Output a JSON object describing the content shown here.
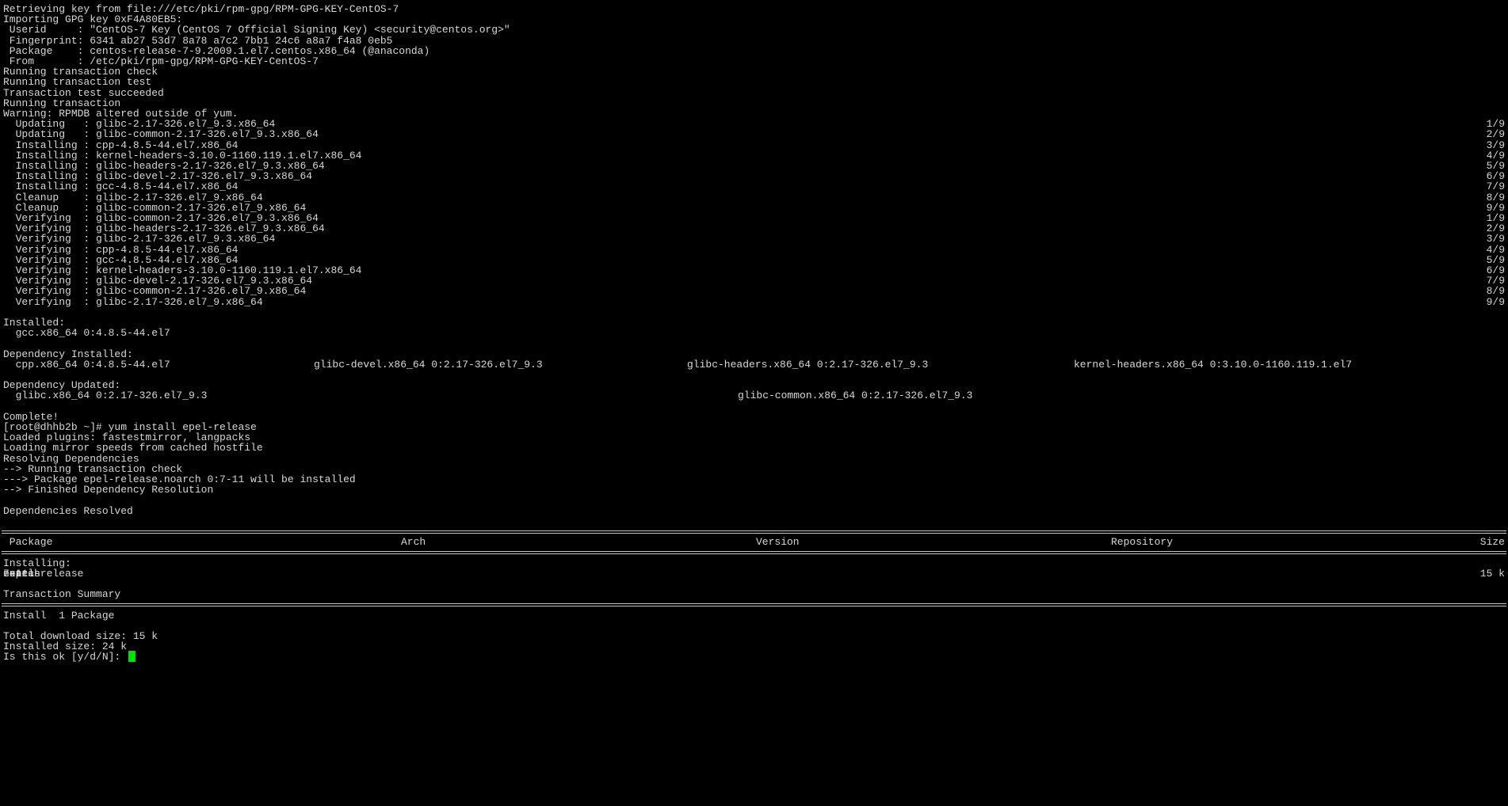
{
  "colors": {
    "background": "#000000",
    "foreground": "#d7d7d7",
    "cursor": "#00e000",
    "rule": "#c8c8c8"
  },
  "terminal": {
    "lines": [
      {
        "segments": [
          {
            "text": "Retrieving key from file:///etc/pki/rpm-gpg/RPM-GPG-KEY-CentOS-7"
          }
        ]
      },
      {
        "segments": [
          {
            "text": "Importing GPG key 0xF4A80EB5:"
          }
        ]
      },
      {
        "segments": [
          {
            "text": " Userid     : \"CentOS-7 Key (CentOS 7 Official Signing Key) <security@centos.org>\""
          }
        ]
      },
      {
        "segments": [
          {
            "text": " Fingerprint: 6341 ab27 53d7 8a78 a7c2 7bb1 24c6 a8a7 f4a8 0eb5"
          }
        ]
      },
      {
        "segments": [
          {
            "text": " Package    : centos-release-7-9.2009.1.el7.centos.x86_64 (@anaconda)"
          }
        ]
      },
      {
        "segments": [
          {
            "text": " From       : /etc/pki/rpm-gpg/RPM-GPG-KEY-CentOS-7"
          }
        ]
      },
      {
        "segments": [
          {
            "text": "Running transaction check"
          }
        ]
      },
      {
        "segments": [
          {
            "text": "Running transaction test"
          }
        ]
      },
      {
        "segments": [
          {
            "text": "Transaction test succeeded"
          }
        ]
      },
      {
        "segments": [
          {
            "text": "Running transaction"
          }
        ]
      },
      {
        "segments": [
          {
            "text": "Warning: RPMDB altered outside of yum."
          }
        ]
      },
      {
        "segments": [
          {
            "text": "  Updating   : glibc-2.17-326.el7_9.3.x86_64"
          },
          {
            "text": "1/9",
            "align": "right"
          }
        ]
      },
      {
        "segments": [
          {
            "text": "  Updating   : glibc-common-2.17-326.el7_9.3.x86_64"
          },
          {
            "text": "2/9",
            "align": "right"
          }
        ]
      },
      {
        "segments": [
          {
            "text": "  Installing : cpp-4.8.5-44.el7.x86_64"
          },
          {
            "text": "3/9",
            "align": "right"
          }
        ]
      },
      {
        "segments": [
          {
            "text": "  Installing : kernel-headers-3.10.0-1160.119.1.el7.x86_64"
          },
          {
            "text": "4/9",
            "align": "right"
          }
        ]
      },
      {
        "segments": [
          {
            "text": "  Installing : glibc-headers-2.17-326.el7_9.3.x86_64"
          },
          {
            "text": "5/9",
            "align": "right"
          }
        ]
      },
      {
        "segments": [
          {
            "text": "  Installing : glibc-devel-2.17-326.el7_9.3.x86_64"
          },
          {
            "text": "6/9",
            "align": "right"
          }
        ]
      },
      {
        "segments": [
          {
            "text": "  Installing : gcc-4.8.5-44.el7.x86_64"
          },
          {
            "text": "7/9",
            "align": "right"
          }
        ]
      },
      {
        "segments": [
          {
            "text": "  Cleanup    : glibc-2.17-326.el7_9.x86_64"
          },
          {
            "text": "8/9",
            "align": "right"
          }
        ]
      },
      {
        "segments": [
          {
            "text": "  Cleanup    : glibc-common-2.17-326.el7_9.x86_64"
          },
          {
            "text": "9/9",
            "align": "right"
          }
        ]
      },
      {
        "segments": [
          {
            "text": "  Verifying  : glibc-common-2.17-326.el7_9.3.x86_64"
          },
          {
            "text": "1/9",
            "align": "right"
          }
        ]
      },
      {
        "segments": [
          {
            "text": "  Verifying  : glibc-headers-2.17-326.el7_9.3.x86_64"
          },
          {
            "text": "2/9",
            "align": "right"
          }
        ]
      },
      {
        "segments": [
          {
            "text": "  Verifying  : glibc-2.17-326.el7_9.3.x86_64"
          },
          {
            "text": "3/9",
            "align": "right"
          }
        ]
      },
      {
        "segments": [
          {
            "text": "  Verifying  : cpp-4.8.5-44.el7.x86_64"
          },
          {
            "text": "4/9",
            "align": "right"
          }
        ]
      },
      {
        "segments": [
          {
            "text": "  Verifying  : gcc-4.8.5-44.el7.x86_64"
          },
          {
            "text": "5/9",
            "align": "right"
          }
        ]
      },
      {
        "segments": [
          {
            "text": "  Verifying  : kernel-headers-3.10.0-1160.119.1.el7.x86_64"
          },
          {
            "text": "6/9",
            "align": "right"
          }
        ]
      },
      {
        "segments": [
          {
            "text": "  Verifying  : glibc-devel-2.17-326.el7_9.3.x86_64"
          },
          {
            "text": "7/9",
            "align": "right"
          }
        ]
      },
      {
        "segments": [
          {
            "text": "  Verifying  : glibc-common-2.17-326.el7_9.x86_64"
          },
          {
            "text": "8/9",
            "align": "right"
          }
        ]
      },
      {
        "segments": [
          {
            "text": "  Verifying  : glibc-2.17-326.el7_9.x86_64"
          },
          {
            "text": "9/9",
            "align": "right"
          }
        ]
      },
      {
        "segments": []
      },
      {
        "segments": [
          {
            "text": "Installed:"
          }
        ]
      },
      {
        "segments": [
          {
            "text": "  gcc.x86_64 0:4.8.5-44.el7"
          }
        ]
      },
      {
        "segments": []
      },
      {
        "segments": [
          {
            "text": "Dependency Installed:"
          }
        ]
      },
      {
        "segments": [
          {
            "text": "  cpp.x86_64 0:4.8.5-44.el7"
          },
          {
            "text": "glibc-devel.x86_64 0:2.17-326.el7_9.3"
          },
          {
            "text": "glibc-headers.x86_64 0:2.17-326.el7_9.3"
          },
          {
            "text": "kernel-headers.x86_64 0:3.10.0-1160.119.1.el7"
          }
        ]
      },
      {
        "segments": []
      },
      {
        "segments": [
          {
            "text": "Dependency Updated:"
          }
        ]
      },
      {
        "segments": [
          {
            "text": "  glibc.x86_64 0:2.17-326.el7_9.3"
          },
          {
            "text": "glibc-common.x86_64 0:2.17-326.el7_9.3"
          }
        ]
      },
      {
        "segments": []
      },
      {
        "segments": [
          {
            "text": "Complete!"
          }
        ]
      },
      {
        "segments": [
          {
            "text": "[root@dhhb2b ~]# yum install epel-release"
          }
        ]
      },
      {
        "segments": [
          {
            "text": "Loaded plugins: fastestmirror, langpacks"
          }
        ]
      },
      {
        "segments": [
          {
            "text": "Loading mirror speeds from cached hostfile"
          }
        ]
      },
      {
        "segments": [
          {
            "text": "Resolving Dependencies"
          }
        ]
      },
      {
        "segments": [
          {
            "text": "--> Running transaction check"
          }
        ]
      },
      {
        "segments": [
          {
            "text": "---> Package epel-release.noarch 0:7-11 will be installed"
          }
        ]
      },
      {
        "segments": [
          {
            "text": "--> Finished Dependency Resolution"
          }
        ]
      },
      {
        "segments": []
      },
      {
        "segments": [
          {
            "text": "Dependencies Resolved"
          }
        ]
      },
      {
        "segments": []
      },
      {
        "rule": true,
        "segments": []
      },
      {
        "segments": [
          {
            "text": " Package"
          },
          {
            "text": "Arch"
          },
          {
            "text": "Version"
          },
          {
            "text": "Repository"
          },
          {
            "text": "Size",
            "align": "right"
          }
        ]
      },
      {
        "rule": true,
        "segments": []
      },
      {
        "segments": [
          {
            "text": "Installing:"
          }
        ]
      },
      {
        "segments": [
          {
            "text": " epel-release"
          },
          {
            "text": "noarch"
          },
          {
            "text": "7-11"
          },
          {
            "text": "extras"
          },
          {
            "text": "15 k",
            "align": "right"
          }
        ]
      },
      {
        "segments": []
      },
      {
        "segments": [
          {
            "text": "Transaction Summary"
          }
        ]
      },
      {
        "rule": true,
        "segments": []
      },
      {
        "segments": [
          {
            "text": "Install  1 Package"
          }
        ]
      },
      {
        "segments": []
      },
      {
        "segments": [
          {
            "text": "Total download size: 15 k"
          }
        ]
      },
      {
        "segments": [
          {
            "text": "Installed size: 24 k"
          }
        ]
      },
      {
        "segments": [
          {
            "text": "Is this ok [y/d/N]: "
          }
        ],
        "prompt": true
      }
    ]
  }
}
